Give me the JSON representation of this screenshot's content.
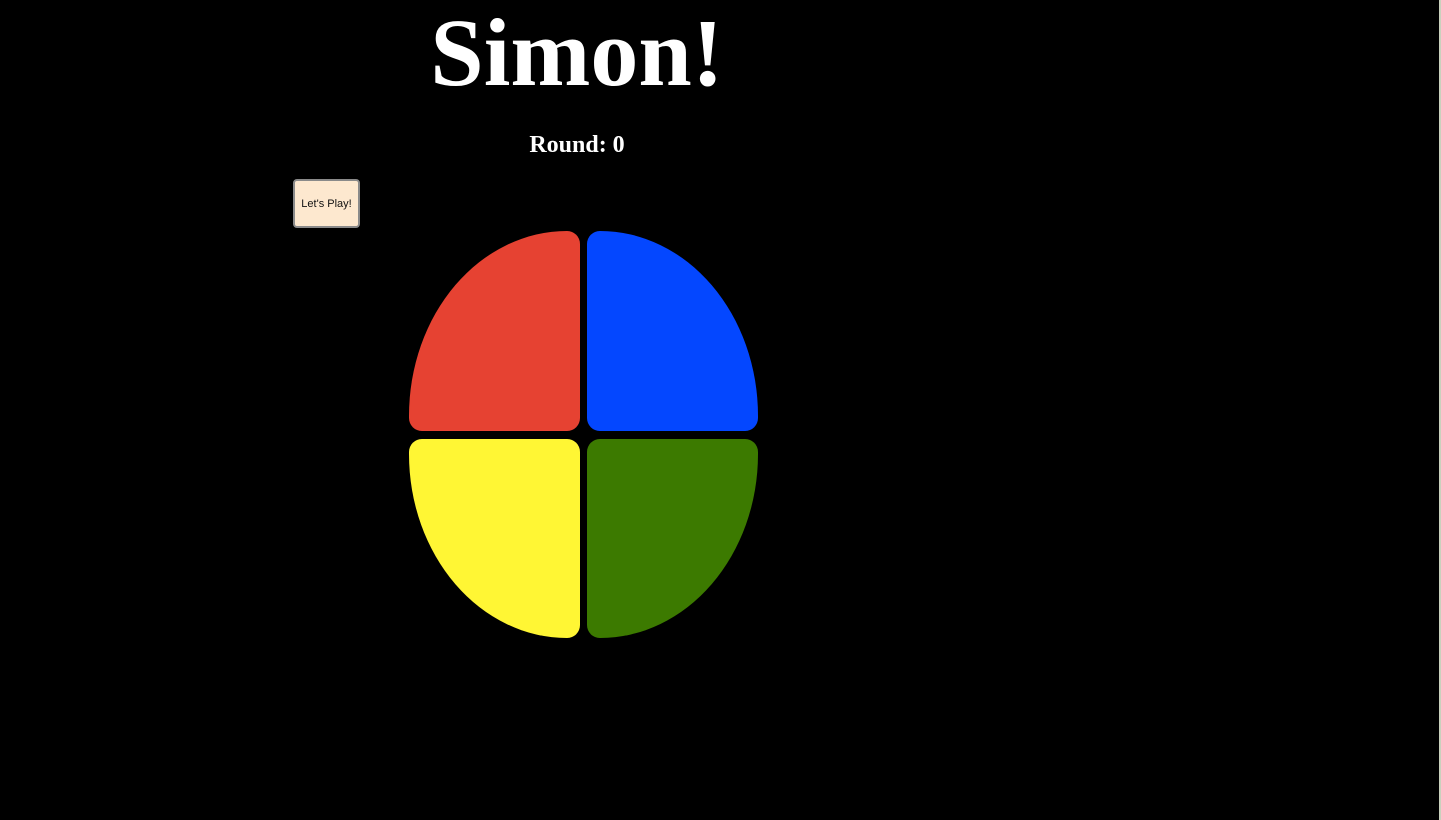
{
  "game": {
    "title": "Simon!",
    "round_label": "Round: 0",
    "round": 0,
    "start_button_label": "Let's Play!"
  },
  "colors": {
    "background": "#000000",
    "red": "#e64232",
    "blue": "#0447ff",
    "yellow": "#fff634",
    "green": "#3c7a00",
    "button_bg": "#fde8cf"
  },
  "pads": [
    {
      "color": "red",
      "icon": "red-pad"
    },
    {
      "color": "blue",
      "icon": "blue-pad"
    },
    {
      "color": "yellow",
      "icon": "yellow-pad"
    },
    {
      "color": "green",
      "icon": "green-pad"
    }
  ]
}
